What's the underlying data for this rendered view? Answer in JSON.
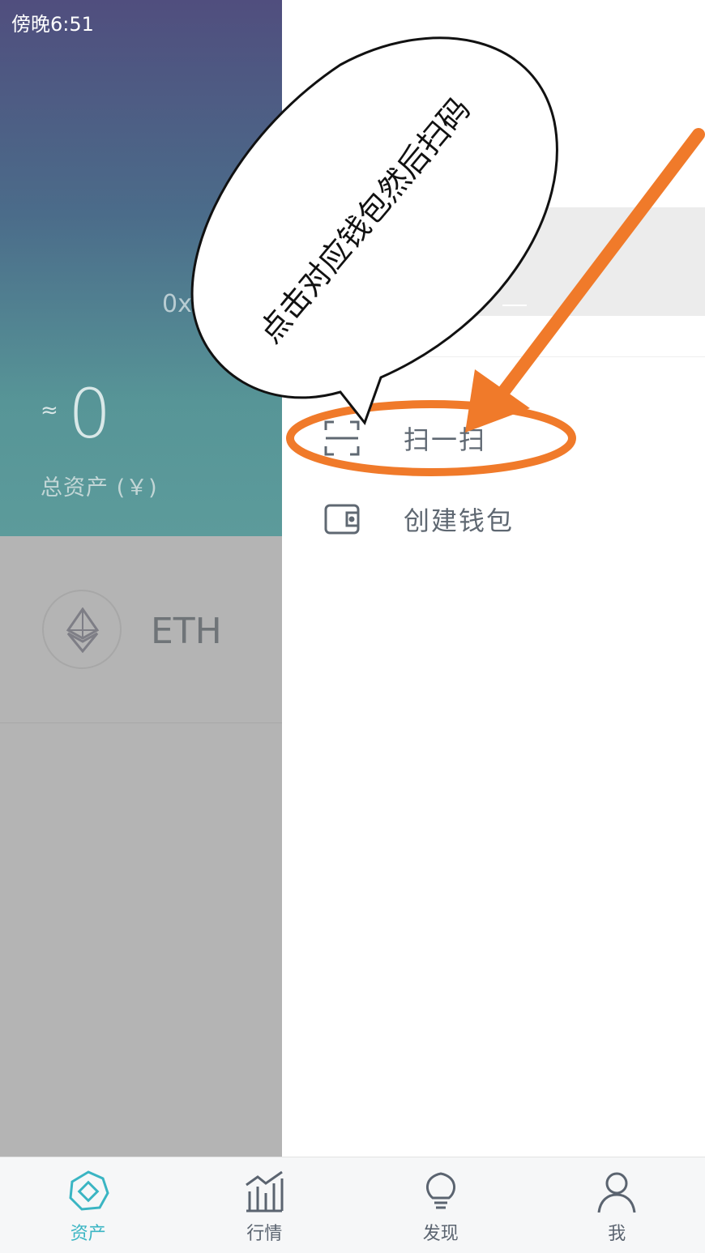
{
  "status_bar": {
    "time": "傍晚6:51"
  },
  "wallet": {
    "address_prefix": "0x",
    "approx_symbol": "≈",
    "total_value": "0",
    "total_label": "总资产 (￥)"
  },
  "assets": [
    {
      "symbol": "ETH",
      "icon": "eth-icon"
    }
  ],
  "drawer": {
    "menu": [
      {
        "label": "扫一扫",
        "icon": "scan-icon"
      },
      {
        "label": "创建钱包",
        "icon": "wallet-icon"
      }
    ]
  },
  "annotation": {
    "bubble_text": "点击对应钱包然后扫码",
    "color": "#f07a2a"
  },
  "tabbar": {
    "tabs": [
      {
        "label": "资产",
        "icon": "assets-icon",
        "active": true
      },
      {
        "label": "行情",
        "icon": "market-chart-icon",
        "active": false
      },
      {
        "label": "发现",
        "icon": "lightbulb-icon",
        "active": false
      },
      {
        "label": "我",
        "icon": "profile-icon",
        "active": false
      }
    ],
    "active_color": "#3ab5c3",
    "inactive_color": "#5b6470"
  }
}
